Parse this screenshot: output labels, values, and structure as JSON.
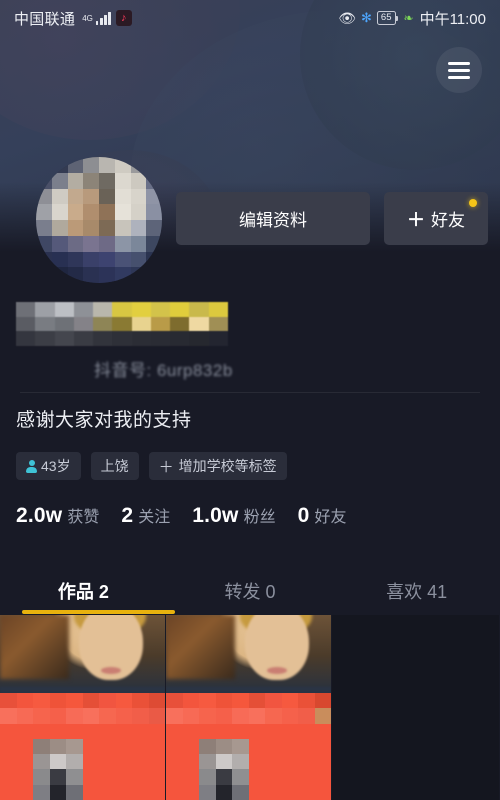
{
  "status_bar": {
    "carrier": "中国联通",
    "network_label": "4G",
    "signal_icon": "signal-bars-icon",
    "app_badge_icon": "tiktok-note-icon",
    "app_badge_glyph": "♪",
    "eye_icon": "eye-protection-icon",
    "eye_glyph": "👁",
    "bluetooth_icon": "bluetooth-icon",
    "bluetooth_glyph": "✻",
    "battery_level": "65",
    "power_saving_icon": "leaf-icon",
    "power_saving_glyph": "❧",
    "time": "中午11:00"
  },
  "header": {
    "menu_icon": "hamburger-menu-icon"
  },
  "profile": {
    "avatar_redacted": true,
    "display_name_redacted": true,
    "handle": "抖音号: 6urp832b",
    "bio": "感谢大家对我的支持",
    "tags": [
      {
        "icon": "person-icon",
        "label": "43岁"
      },
      {
        "icon": "",
        "label": "上饶"
      },
      {
        "icon": "plus-icon",
        "label": "增加学校等标签",
        "plus": "＋"
      }
    ]
  },
  "actions": {
    "edit_profile_label": "编辑资料",
    "add_friend_plus": "＋",
    "add_friend_label": "好友",
    "badge_color": "#f5c518",
    "has_badge": true
  },
  "stats": [
    {
      "value": "2.0w",
      "label": "获赞"
    },
    {
      "value": "2",
      "label": "关注"
    },
    {
      "value": "1.0w",
      "label": "粉丝"
    },
    {
      "value": "0",
      "label": "好友"
    }
  ],
  "tabs": [
    {
      "label": "作品 2",
      "active": true
    },
    {
      "label": "转发 0",
      "active": false
    },
    {
      "label": "喜欢 41",
      "active": false
    }
  ],
  "tab_indicator_color": "#e8b20e",
  "grid": {
    "cells": [
      {
        "type": "video-thumbnail",
        "redacted": true
      },
      {
        "type": "video-thumbnail",
        "redacted": true
      },
      {
        "type": "empty",
        "redacted": false
      }
    ]
  },
  "colors": {
    "page_background": "#181a26",
    "cover_background": "#353d52",
    "button_background": "#3a3d4a",
    "chip_background": "#2a2d3a",
    "accent_yellow": "#e8b20e",
    "muted_text": "#9ba1b0",
    "overlay_red": "#f5553d",
    "tag_icon_cyan": "#3fc3d6"
  }
}
